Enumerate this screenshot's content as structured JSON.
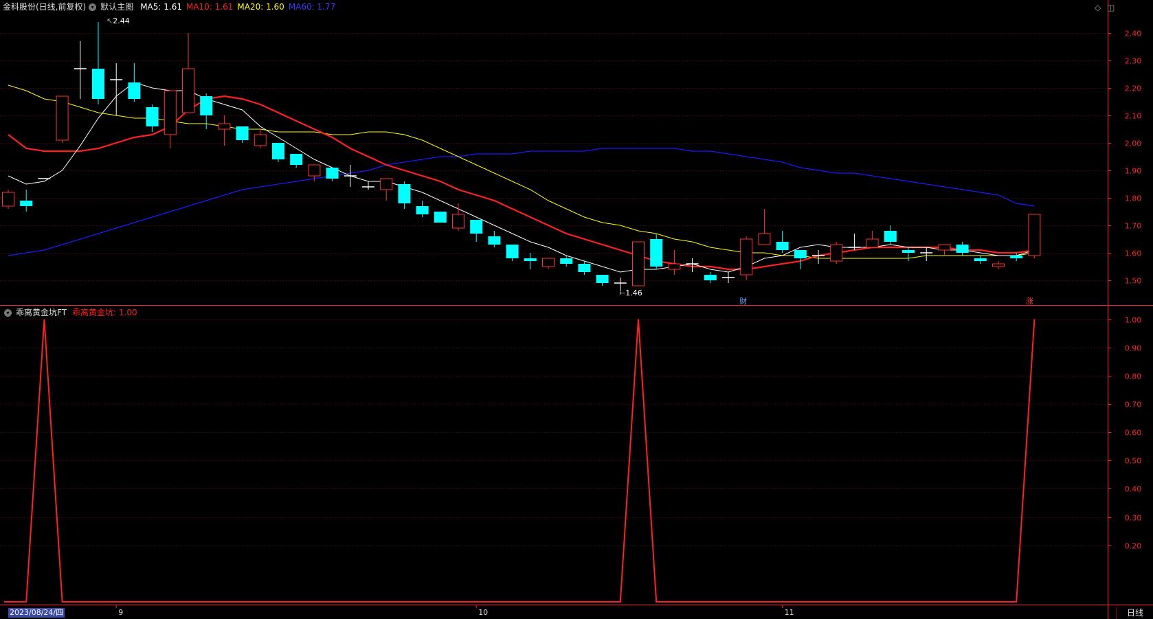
{
  "header": {
    "stock_name": "金科股份(日线,前复权)",
    "chart_set": "默认主图",
    "ma5": "MA5: 1.61",
    "ma10": "MA10: 1.61",
    "ma20": "MA20: 1.60",
    "ma60": "MA60: 1.77"
  },
  "indicator": {
    "name": "乖离黄金坑FT",
    "value_label": "乖离黄金坑: 1.00"
  },
  "markers": {
    "fin": "财",
    "rise": "涨",
    "high": "2.44",
    "low": "1.46"
  },
  "bottom": {
    "current_date": "2023/08/24/四",
    "timeframe": "日线"
  },
  "colors": {
    "up": "#ff3030",
    "down": "#00ffff",
    "doji": "#ffffff",
    "ma5": "#ffffff",
    "ma10": "#ff2020",
    "ma20": "#ffff00",
    "ma60": "#1a1aff",
    "axis": "#ff2020",
    "grid": "#6b0000"
  },
  "chart_data": [
    {
      "type": "candlestick",
      "ylim": [
        1.41,
        2.47
      ],
      "y_ticks": [
        "2.40",
        "2.30",
        "2.20",
        "2.10",
        "2.00",
        "1.90",
        "1.80",
        "1.70",
        "1.60",
        "1.50"
      ],
      "x_labels": [
        {
          "label": "9",
          "index": 6
        },
        {
          "label": "10",
          "index": 26
        },
        {
          "label": "11",
          "index": 43
        }
      ],
      "candles": [
        [
          1.77,
          1.82,
          1.83,
          1.76
        ],
        [
          1.79,
          1.77,
          1.83,
          1.75
        ],
        [
          1.87,
          1.87,
          1.87,
          1.87
        ],
        [
          2.01,
          2.17,
          2.17,
          2.0
        ],
        [
          2.27,
          2.27,
          2.37,
          2.16
        ],
        [
          2.27,
          2.16,
          2.44,
          2.14
        ],
        [
          2.23,
          2.23,
          2.29,
          2.1
        ],
        [
          2.22,
          2.16,
          2.29,
          2.15
        ],
        [
          2.13,
          2.06,
          2.14,
          2.04
        ],
        [
          2.03,
          2.19,
          2.19,
          1.98
        ],
        [
          2.11,
          2.27,
          2.4,
          2.11
        ],
        [
          2.17,
          2.1,
          2.18,
          2.05
        ],
        [
          2.05,
          2.07,
          2.1,
          1.99
        ],
        [
          2.06,
          2.01,
          2.06,
          2.0
        ],
        [
          1.99,
          2.03,
          2.05,
          1.98
        ],
        [
          2.0,
          1.94,
          2.0,
          1.93
        ],
        [
          1.96,
          1.92,
          1.96,
          1.91
        ],
        [
          1.88,
          1.92,
          1.92,
          1.86
        ],
        [
          1.91,
          1.87,
          1.91,
          1.86
        ],
        [
          1.88,
          1.88,
          1.92,
          1.84
        ],
        [
          1.84,
          1.84,
          1.86,
          1.83
        ],
        [
          1.83,
          1.87,
          1.87,
          1.79
        ],
        [
          1.85,
          1.78,
          1.86,
          1.76
        ],
        [
          1.77,
          1.74,
          1.79,
          1.73
        ],
        [
          1.75,
          1.71,
          1.75,
          1.71
        ],
        [
          1.69,
          1.74,
          1.78,
          1.68
        ],
        [
          1.72,
          1.67,
          1.72,
          1.64
        ],
        [
          1.66,
          1.63,
          1.68,
          1.62
        ],
        [
          1.63,
          1.58,
          1.63,
          1.57
        ],
        [
          1.58,
          1.57,
          1.6,
          1.54
        ],
        [
          1.55,
          1.58,
          1.58,
          1.54
        ],
        [
          1.58,
          1.56,
          1.59,
          1.55
        ],
        [
          1.56,
          1.53,
          1.57,
          1.52
        ],
        [
          1.52,
          1.49,
          1.52,
          1.48
        ],
        [
          1.49,
          1.49,
          1.51,
          1.46
        ],
        [
          1.48,
          1.64,
          1.64,
          1.48
        ],
        [
          1.65,
          1.55,
          1.67,
          1.54
        ],
        [
          1.54,
          1.56,
          1.61,
          1.52
        ],
        [
          1.56,
          1.56,
          1.58,
          1.53
        ],
        [
          1.52,
          1.5,
          1.53,
          1.49
        ],
        [
          1.51,
          1.51,
          1.53,
          1.49
        ],
        [
          1.52,
          1.65,
          1.66,
          1.5
        ],
        [
          1.63,
          1.67,
          1.76,
          1.63
        ],
        [
          1.64,
          1.61,
          1.68,
          1.6
        ],
        [
          1.61,
          1.58,
          1.61,
          1.54
        ],
        [
          1.59,
          1.59,
          1.61,
          1.56
        ],
        [
          1.57,
          1.63,
          1.64,
          1.56
        ],
        [
          1.62,
          1.62,
          1.67,
          1.61
        ],
        [
          1.62,
          1.65,
          1.68,
          1.62
        ],
        [
          1.68,
          1.64,
          1.7,
          1.63
        ],
        [
          1.61,
          1.6,
          1.62,
          1.57
        ],
        [
          1.6,
          1.6,
          1.62,
          1.57
        ],
        [
          1.61,
          1.63,
          1.63,
          1.59
        ],
        [
          1.63,
          1.6,
          1.64,
          1.59
        ],
        [
          1.58,
          1.57,
          1.59,
          1.56
        ],
        [
          1.55,
          1.56,
          1.57,
          1.54
        ],
        [
          1.59,
          1.58,
          1.6,
          1.57
        ],
        [
          1.59,
          1.74,
          1.74,
          1.58
        ]
      ],
      "ma5": [
        1.88,
        1.85,
        1.86,
        1.9,
        1.99,
        2.09,
        2.17,
        2.22,
        2.2,
        2.19,
        2.19,
        2.16,
        2.14,
        2.12,
        2.06,
        2.02,
        1.98,
        1.94,
        1.91,
        1.88,
        1.86,
        1.86,
        1.84,
        1.82,
        1.79,
        1.76,
        1.73,
        1.7,
        1.67,
        1.64,
        1.62,
        1.59,
        1.57,
        1.55,
        1.53,
        1.54,
        1.54,
        1.55,
        1.56,
        1.54,
        1.53,
        1.55,
        1.58,
        1.59,
        1.62,
        1.63,
        1.62,
        1.62,
        1.62,
        1.63,
        1.62,
        1.62,
        1.61,
        1.61,
        1.6,
        1.59,
        1.59,
        1.61
      ],
      "ma10": [
        2.03,
        1.98,
        1.97,
        1.97,
        1.97,
        1.98,
        2.0,
        2.02,
        2.03,
        2.06,
        2.12,
        2.16,
        2.17,
        2.16,
        2.14,
        2.11,
        2.08,
        2.05,
        2.02,
        1.98,
        1.95,
        1.92,
        1.9,
        1.88,
        1.86,
        1.83,
        1.81,
        1.79,
        1.76,
        1.73,
        1.7,
        1.67,
        1.65,
        1.63,
        1.61,
        1.59,
        1.57,
        1.56,
        1.55,
        1.55,
        1.54,
        1.54,
        1.55,
        1.56,
        1.57,
        1.59,
        1.6,
        1.61,
        1.62,
        1.62,
        1.62,
        1.62,
        1.62,
        1.61,
        1.61,
        1.6,
        1.6,
        1.61
      ],
      "ma20": [
        2.21,
        2.19,
        2.16,
        2.15,
        2.13,
        2.11,
        2.1,
        2.09,
        2.09,
        2.08,
        2.07,
        2.07,
        2.06,
        2.05,
        2.05,
        2.04,
        2.04,
        2.04,
        2.03,
        2.03,
        2.04,
        2.04,
        2.03,
        2.01,
        1.98,
        1.95,
        1.92,
        1.89,
        1.86,
        1.83,
        1.79,
        1.76,
        1.73,
        1.71,
        1.7,
        1.68,
        1.67,
        1.65,
        1.64,
        1.62,
        1.61,
        1.6,
        1.6,
        1.59,
        1.59,
        1.58,
        1.58,
        1.58,
        1.58,
        1.58,
        1.58,
        1.59,
        1.59,
        1.59,
        1.59,
        1.59,
        1.59,
        1.6
      ],
      "ma60": [
        1.59,
        1.6,
        1.61,
        1.63,
        1.65,
        1.67,
        1.69,
        1.71,
        1.73,
        1.75,
        1.77,
        1.79,
        1.81,
        1.83,
        1.84,
        1.85,
        1.86,
        1.87,
        1.88,
        1.89,
        1.9,
        1.92,
        1.93,
        1.94,
        1.95,
        1.95,
        1.96,
        1.96,
        1.96,
        1.97,
        1.97,
        1.97,
        1.97,
        1.98,
        1.98,
        1.98,
        1.98,
        1.98,
        1.97,
        1.97,
        1.96,
        1.95,
        1.94,
        1.93,
        1.91,
        1.9,
        1.89,
        1.89,
        1.88,
        1.87,
        1.86,
        1.85,
        1.84,
        1.83,
        1.82,
        1.81,
        1.78,
        1.77
      ]
    },
    {
      "type": "line",
      "series_name": "乖离黄金坑",
      "ylim": [
        0,
        1.05
      ],
      "y_ticks": [
        "1.00",
        "0.90",
        "0.80",
        "0.70",
        "0.60",
        "0.50",
        "0.40",
        "0.30",
        "0.20"
      ],
      "values": [
        0,
        0,
        1,
        0,
        0,
        0,
        0,
        0,
        0,
        0,
        0,
        0,
        0,
        0,
        0,
        0,
        0,
        0,
        0,
        0,
        0,
        0,
        0,
        0,
        0,
        0,
        0,
        0,
        0,
        0,
        0,
        0,
        0,
        0,
        0,
        1,
        0,
        0,
        0,
        0,
        0,
        0,
        0,
        0,
        0,
        0,
        0,
        0,
        0,
        0,
        0,
        0,
        0,
        0,
        0,
        0,
        0,
        1
      ]
    }
  ]
}
